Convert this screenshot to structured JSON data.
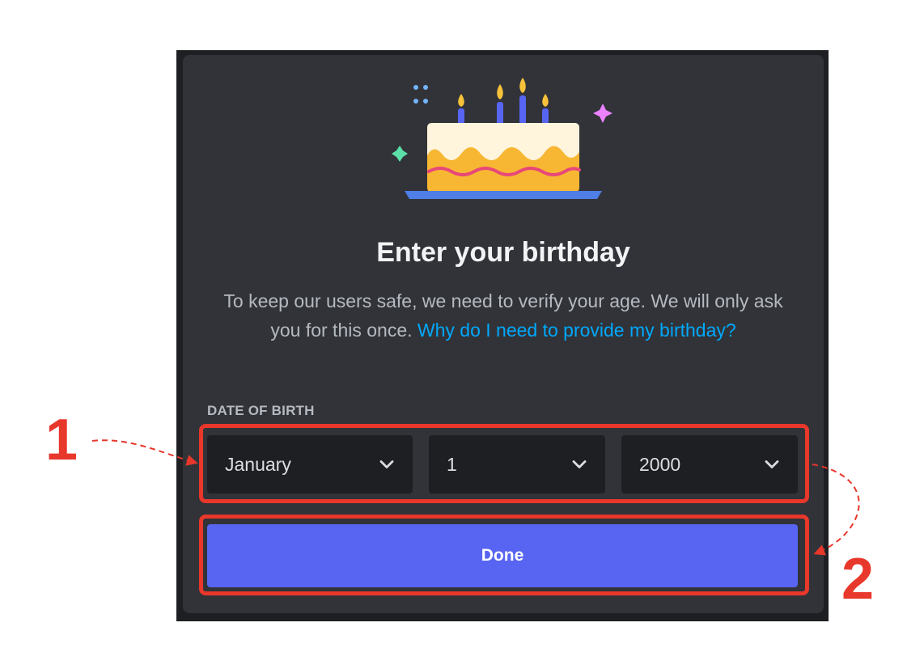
{
  "dialog": {
    "title": "Enter your birthday",
    "description": "To keep our users safe, we need to verify your age. We will only ask you for this once.",
    "help_link": "Why do I need to provide my birthday?",
    "dob_label": "DATE OF BIRTH",
    "month": {
      "value": "January",
      "icon": "chevron-down-icon"
    },
    "day": {
      "value": "1",
      "icon": "chevron-down-icon"
    },
    "year": {
      "value": "2000",
      "icon": "chevron-down-icon"
    },
    "done_label": "Done",
    "illustration": "birthday-cake-icon"
  },
  "annotations": {
    "step_1": "1",
    "step_2": "2",
    "color": "#e8372b"
  },
  "colors": {
    "modal_bg": "#313338",
    "select_bg": "#1e1f22",
    "link": "#00a8fc",
    "button": "#5865f2"
  }
}
